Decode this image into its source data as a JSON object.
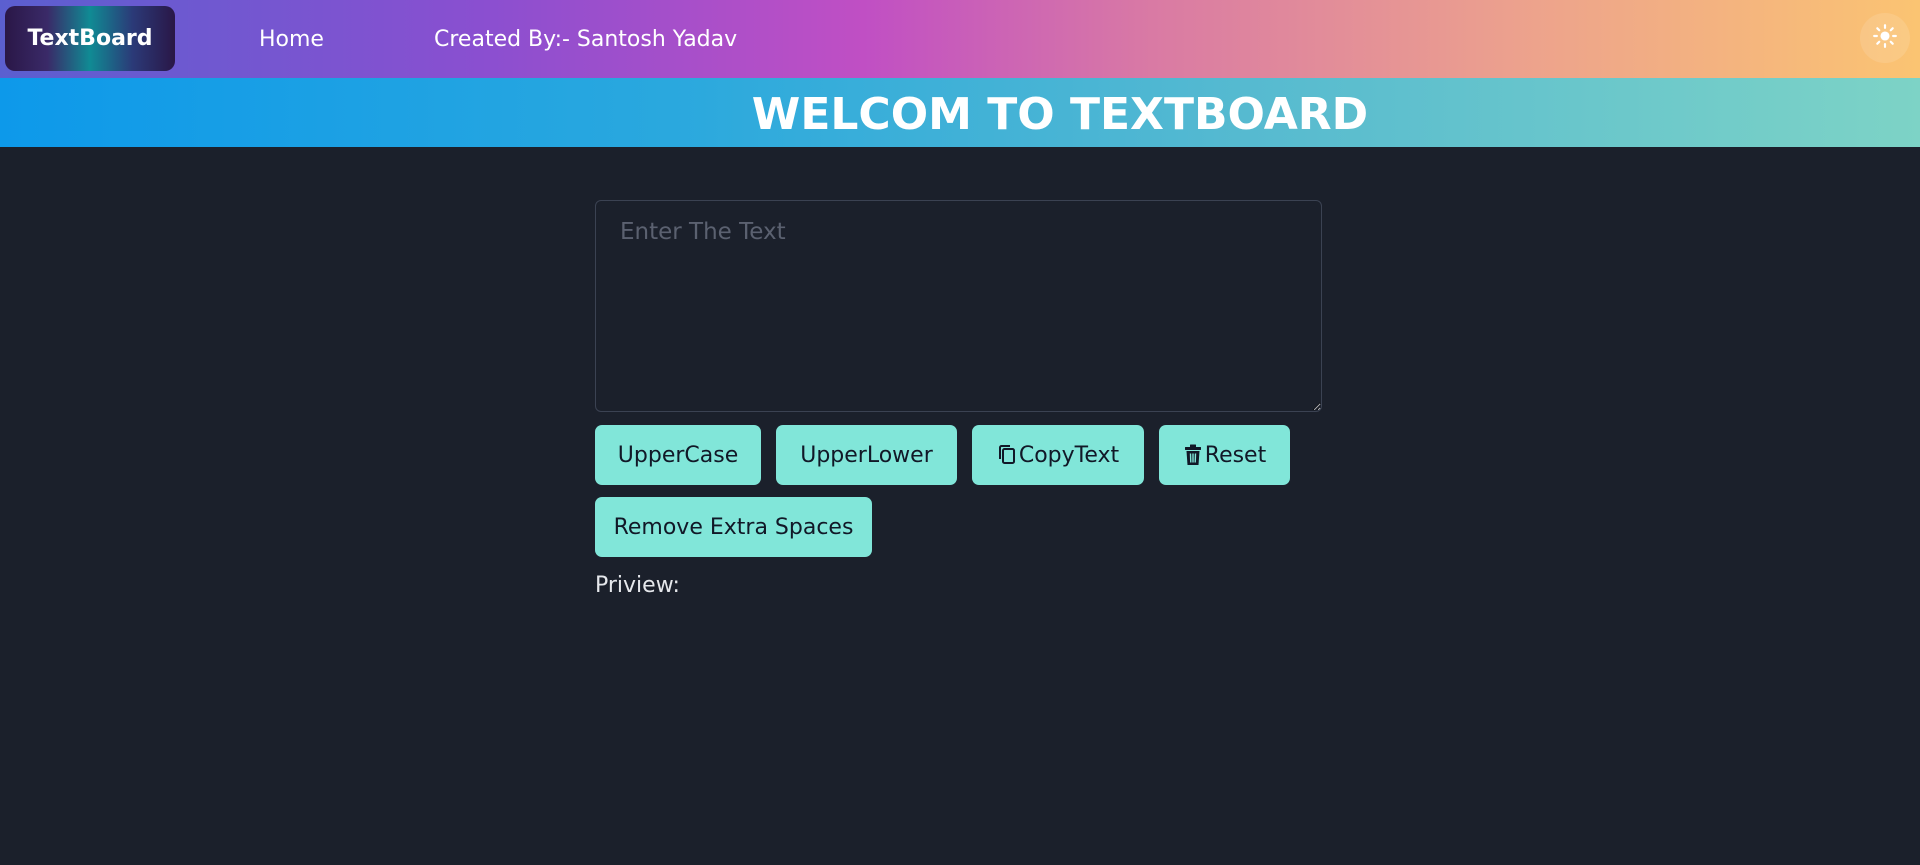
{
  "navbar": {
    "brand": "TextBoard",
    "home": "Home",
    "created_by": "Created By:- Santosh Yadav",
    "theme_icon": "sun-icon"
  },
  "hero": {
    "title": "WELCOM TO TEXTBOARD"
  },
  "editor": {
    "placeholder": "Enter The Text",
    "value": ""
  },
  "actions": {
    "uppercase": "UpperCase",
    "upperlower": "UpperLower",
    "copy": "CopyText",
    "copy_icon": "copy-icon",
    "reset": "Reset",
    "reset_icon": "trash-icon",
    "remove_spaces": "Remove Extra Spaces"
  },
  "preview": {
    "label": "Priview:"
  },
  "colors": {
    "page_bg": "#1b202b",
    "button_bg": "#81e6d9",
    "button_text": "#111827",
    "text": "#e5e7eb"
  }
}
